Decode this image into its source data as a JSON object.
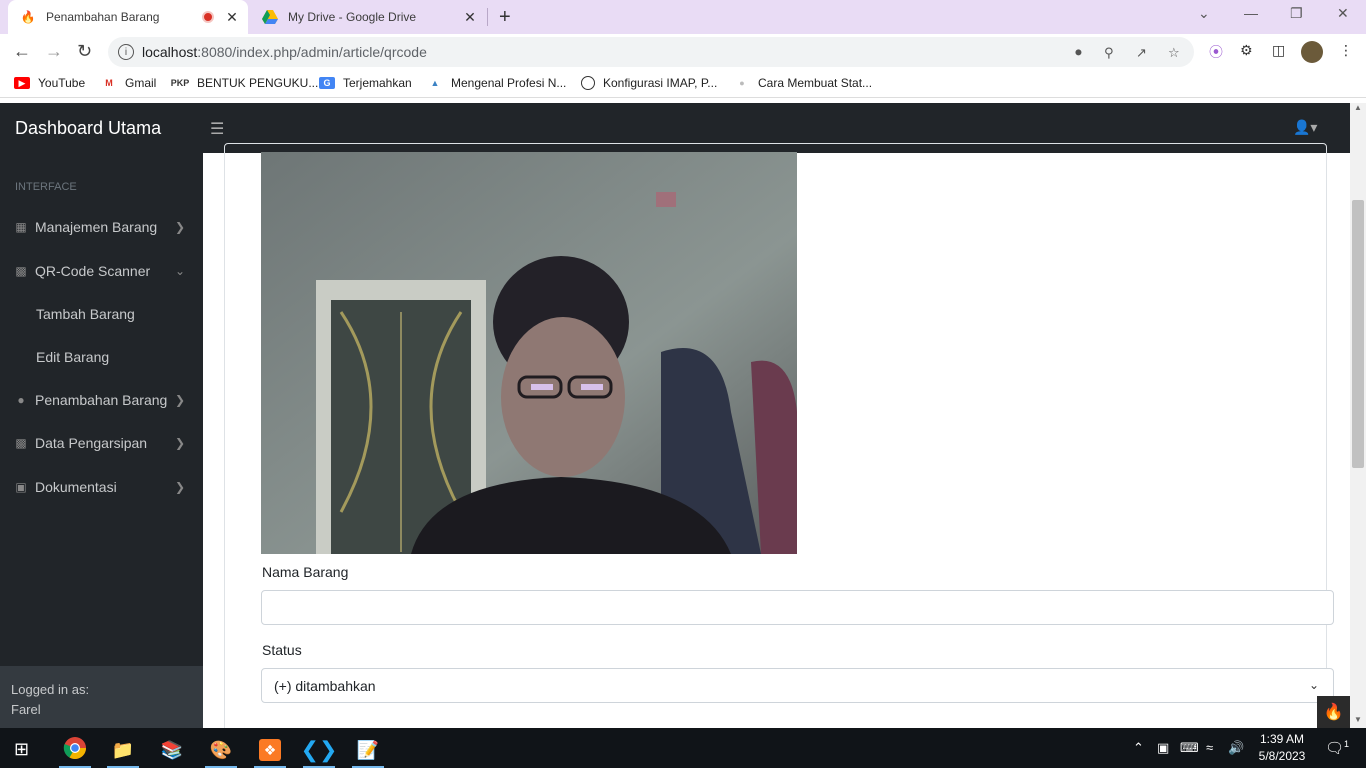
{
  "browser": {
    "tabs": [
      {
        "title": "Penambahan Barang",
        "active": true
      },
      {
        "title": "My Drive - Google Drive",
        "active": false
      }
    ],
    "url_host": "localhost",
    "url_rest": ":8080/index.php/admin/article/qrcode",
    "bookmarks": [
      {
        "label": "YouTube",
        "icon": "youtube-icon"
      },
      {
        "label": "Gmail",
        "icon": "gmail-icon"
      },
      {
        "label": "BENTUK PENGUKU...",
        "icon": "pkp-icon",
        "icon_text": "PKP"
      },
      {
        "label": "Terjemahkan",
        "icon": "translate-icon"
      },
      {
        "label": "Mengenal Profesi N...",
        "icon": "site-icon"
      },
      {
        "label": "Konfigurasi IMAP, P...",
        "icon": "site-icon"
      },
      {
        "label": "Cara Membuat Stat...",
        "icon": "site-icon"
      }
    ]
  },
  "app": {
    "brand": "Dashboard Utama",
    "sidebar": {
      "heading": "Interface",
      "items": [
        {
          "label": "Manajemen Barang",
          "icon": "table-icon",
          "expanded": false
        },
        {
          "label": "QR-Code Scanner",
          "icon": "qrcode-icon",
          "expanded": true
        },
        {
          "label": "Penambahan Barang",
          "icon": "circle-icon",
          "expanded": false
        },
        {
          "label": "Data Pengarsipan",
          "icon": "file-icon",
          "expanded": false
        },
        {
          "label": "Dokumentasi",
          "icon": "image-icon",
          "expanded": false
        }
      ],
      "subitems": [
        "Tambah Barang",
        "Edit Barang"
      ],
      "footer_label": "Logged in as:",
      "footer_user": "Farel"
    },
    "form": {
      "nama_label": "Nama Barang",
      "nama_value": "",
      "status_label": "Status",
      "status_selected": "(+) ditambahkan"
    }
  },
  "taskbar": {
    "time": "1:39 AM",
    "date": "5/8/2023",
    "notification_count": "1"
  },
  "colors": {
    "sidebar_bg": "#212529",
    "tabbar_bg": "#e9dcf5",
    "taskbar_bg": "#101418"
  }
}
